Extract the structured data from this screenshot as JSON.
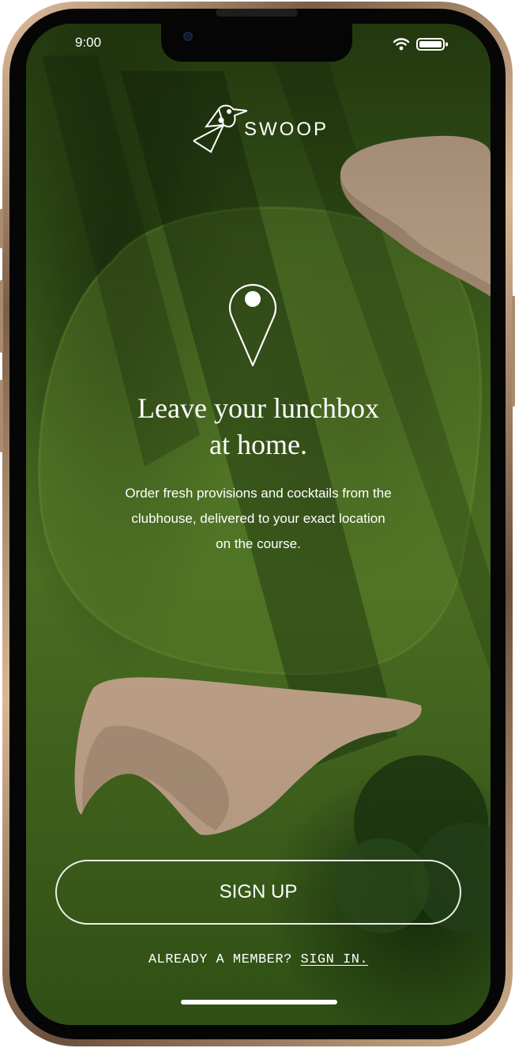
{
  "status_bar": {
    "time": "9:00",
    "icons": [
      "wifi-icon",
      "battery-icon"
    ]
  },
  "brand": {
    "name": "SWOOP",
    "logo_icon": "bird-icon"
  },
  "hero": {
    "icon": "location-pin-icon",
    "headline_line1": "Leave your lunchbox",
    "headline_line2": "at home.",
    "body_line1": "Order fresh provisions and cocktails from the",
    "body_line2": "clubhouse, delivered to your exact location",
    "body_line3": "on the course."
  },
  "actions": {
    "signup_label": "SIGN UP",
    "member_prompt": "ALREADY A MEMBER?",
    "signin_label": "SIGN IN."
  },
  "colors": {
    "text": "#ffffff",
    "frame_gold": "#c9a882",
    "grass": "#4a6f22",
    "sand": "#c9ab90"
  }
}
